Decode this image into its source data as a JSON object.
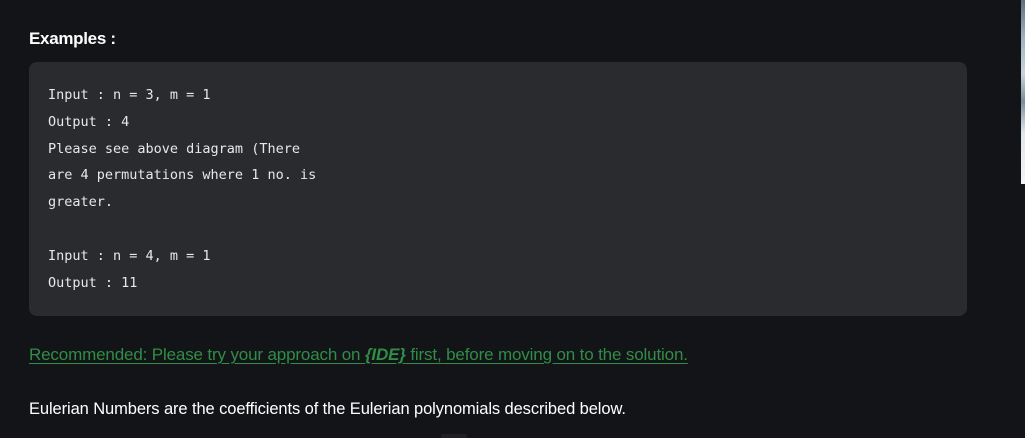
{
  "examples": {
    "heading": "Examples :",
    "code_lines": [
      "Input : n = 3, m = 1",
      "Output : 4",
      "Please see above diagram (There",
      "are 4 permutations where 1 no. is",
      "greater.",
      "",
      "Input : n = 4, m = 1",
      "Output : 11"
    ]
  },
  "recommended": {
    "prefix": "Recommended: Please try your approach on ",
    "ide_label": "{IDE}",
    "suffix": " first, before moving on to the solution."
  },
  "description": "Eulerian Numbers are the coefficients of the Eulerian polynomials described below.",
  "colors": {
    "background": "#131417",
    "code_background": "#2a2b2f",
    "link_green": "#2f8d46",
    "text": "#ffffff"
  }
}
